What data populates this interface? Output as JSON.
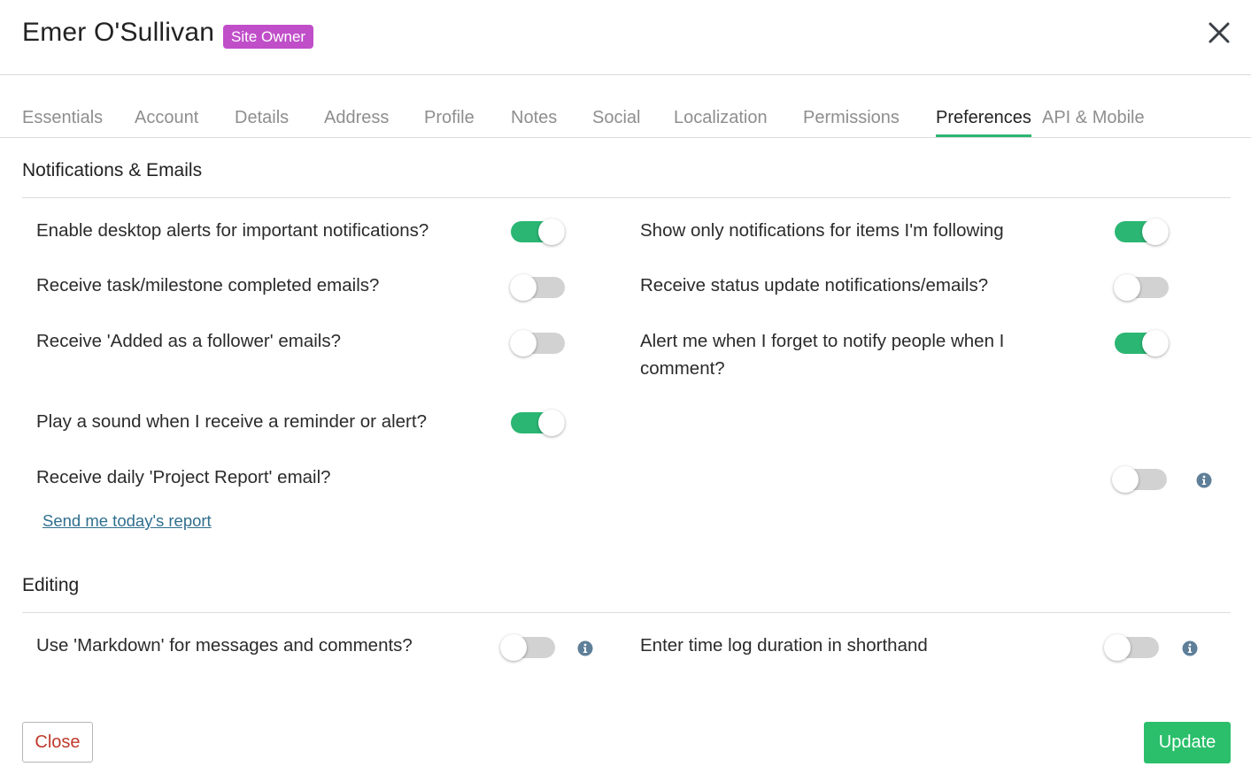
{
  "header": {
    "name": "Emer O'Sullivan",
    "role_badge": "Site Owner",
    "close_icon": "close-icon"
  },
  "tabs": [
    {
      "label": "Essentials",
      "active": false
    },
    {
      "label": "Account",
      "active": false
    },
    {
      "label": "Details",
      "active": false
    },
    {
      "label": "Address",
      "active": false
    },
    {
      "label": "Profile",
      "active": false
    },
    {
      "label": "Notes",
      "active": false
    },
    {
      "label": "Social",
      "active": false
    },
    {
      "label": "Localization",
      "active": false
    },
    {
      "label": "Permissions",
      "active": false
    },
    {
      "label": "Preferences",
      "active": true
    },
    {
      "label": "API & Mobile",
      "active": false
    }
  ],
  "sections": {
    "notifications": {
      "title": "Notifications & Emails",
      "settings": [
        {
          "label": "Enable desktop alerts for important notifications?",
          "on": true
        },
        {
          "label": "Show only notifications for items I'm following",
          "on": true
        },
        {
          "label": "Receive task/milestone completed emails?",
          "on": false
        },
        {
          "label": "Receive status update notifications/emails?",
          "on": false
        },
        {
          "label": "Receive 'Added as a follower' emails?",
          "on": false
        },
        {
          "label": "Alert me when I forget to notify people when I comment?",
          "on": true
        },
        {
          "label": "Play a sound when I receive a reminder or alert?",
          "on": true
        },
        {
          "label": "Receive daily 'Project Report' email?",
          "on": false,
          "info_icon": "info-icon"
        }
      ],
      "report_link": "Send me today's report"
    },
    "editing": {
      "title": "Editing",
      "settings": [
        {
          "label": "Use 'Markdown' for messages and comments?",
          "on": false,
          "info_icon": "info-icon"
        },
        {
          "label": "Enter time log duration in shorthand",
          "on": false,
          "info_icon": "info-icon"
        }
      ]
    }
  },
  "footer": {
    "close_label": "Close",
    "update_label": "Update"
  },
  "colors": {
    "accent_green": "#2bb673",
    "badge_purple": "#c04ec9",
    "close_red": "#c0392b",
    "toggle_off": "#d2d2d2",
    "link_blue": "#2f6f8f"
  }
}
